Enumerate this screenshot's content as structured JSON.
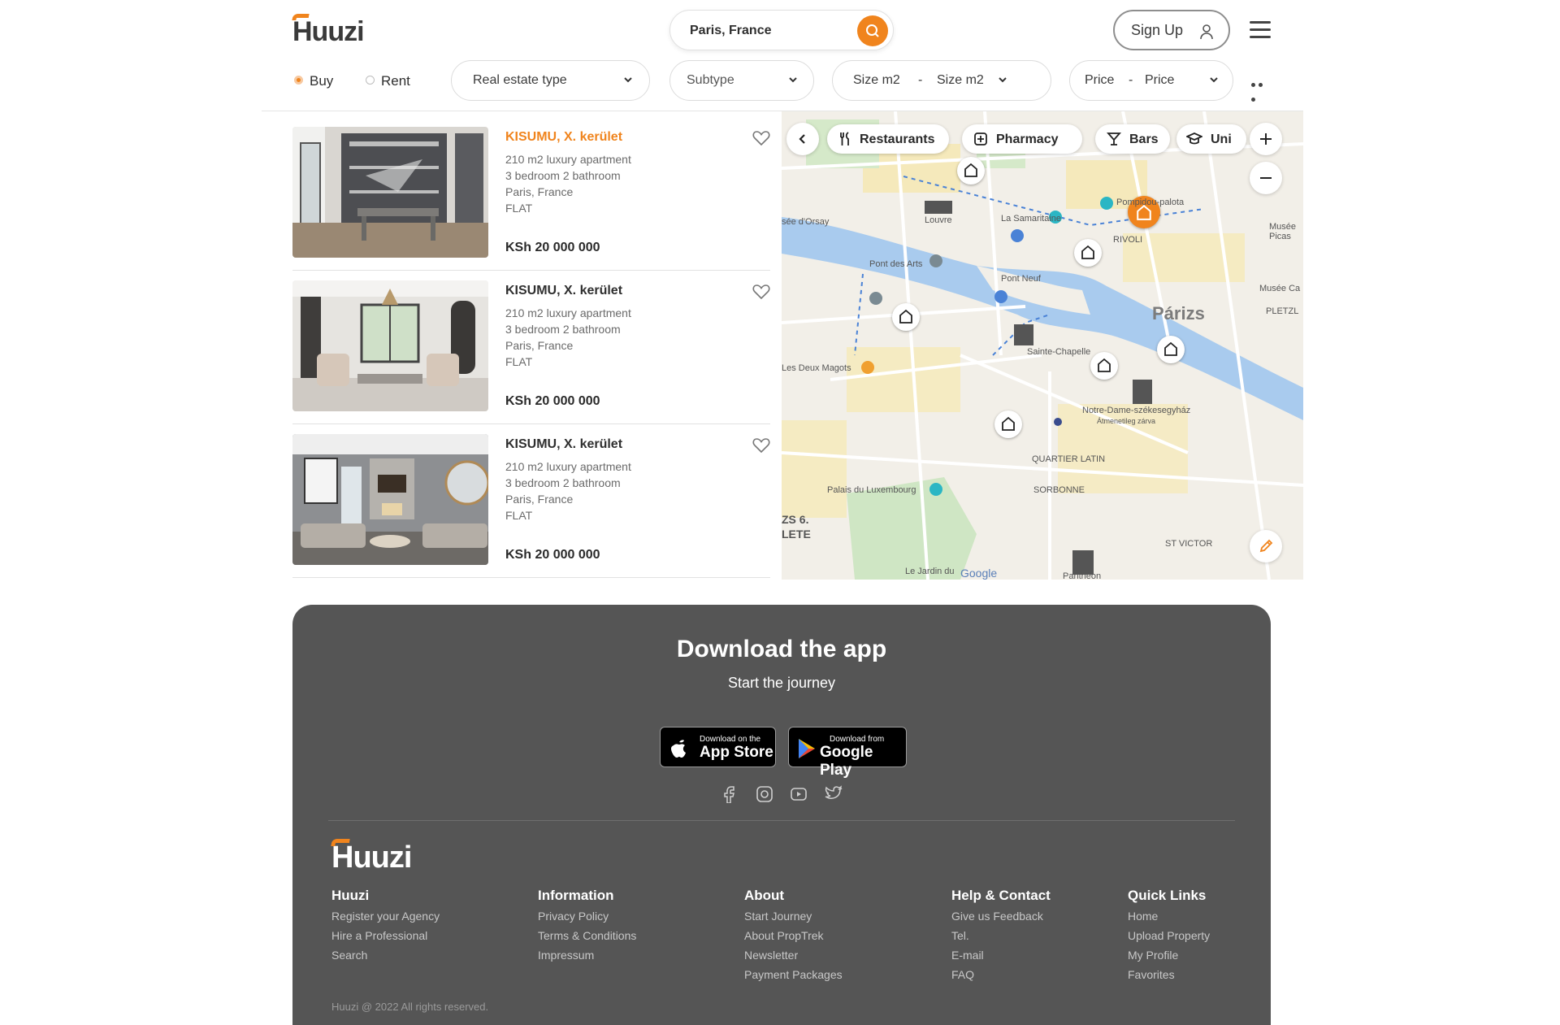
{
  "header": {
    "logo": "Huuzi",
    "search_value": "Paris, France",
    "signup_label": "Sign Up"
  },
  "filters": {
    "buy_label": "Buy",
    "rent_label": "Rent",
    "real_estate_type": "Real estate type",
    "subtype": "Subtype",
    "size_min": "Size m2",
    "size_sep": "-",
    "size_max": "Size m2",
    "price_min": "Price",
    "price_sep": "-",
    "price_max": "Price"
  },
  "listings": [
    {
      "title": "KISUMU, X. kerület",
      "line1": "210 m2 luxury apartment",
      "line2": "3 bedroom 2 bathroom",
      "line3": "Paris, France",
      "line4": "FLAT",
      "price": "KSh 20 000 000"
    },
    {
      "title": "KISUMU, X. kerület",
      "line1": "210 m2 luxury apartment",
      "line2": "3 bedroom 2 bathroom",
      "line3": "Paris, France",
      "line4": "FLAT",
      "price": "KSh 20 000 000"
    },
    {
      "title": "KISUMU, X. kerület",
      "line1": "210 m2 luxury apartment",
      "line2": "3 bedroom 2 bathroom",
      "line3": "Paris, France",
      "line4": "FLAT",
      "price": "KSh 20 000 000"
    }
  ],
  "map": {
    "chips": {
      "restaurants": "Restaurants",
      "pharmacy": "Pharmacy",
      "bars": "Bars",
      "uni": "Uni"
    },
    "labels": {
      "louvre": "Louvre",
      "samaritaine": "La Samaritaine",
      "pompidou": "Pompidou-palota",
      "rivoli": "RIVOLI",
      "pont_des_arts": "Pont des Arts",
      "pont_neuf": "Pont Neuf",
      "parizs": "Párizs",
      "sainte_chapelle": "Sainte-Chapelle",
      "deux_magots": "Les Deux Magots",
      "notre_dame": "Notre-Dame-székesegyház",
      "notre_dame_sub": "Átmenetileg zárva",
      "quartier_latin": "QUARTIER LATIN",
      "sorbonne": "SORBONNE",
      "luxembourg": "Palais du Luxembourg",
      "jardin": "Le Jardin du",
      "pantheon": "Panthéon",
      "st_victor": "ST VICTOR",
      "orsay": "sée d'Orsay",
      "pletzl": "PLETZL",
      "musee_ca": "Musée Ca",
      "musee_picas": "Musée Picas",
      "zs6": "ZS 6.",
      "lete": "LETE",
      "google": "Google"
    }
  },
  "footer": {
    "download_title": "Download the app",
    "download_sub": "Start the journey",
    "appstore_small": "Download on the",
    "appstore_big": "App Store",
    "gplay_small": "Download from",
    "gplay_big": "Google Play",
    "logo": "Huuzi",
    "columns": [
      {
        "title": "Huuzi",
        "links": [
          "Register your Agency",
          "Hire a Professional",
          "Search"
        ]
      },
      {
        "title": "Information",
        "links": [
          "Privacy Policy",
          "Terms & Conditions",
          "Impressum"
        ]
      },
      {
        "title": "About",
        "links": [
          "Start Journey",
          "About PropTrek",
          "Newsletter",
          "Payment Packages"
        ]
      },
      {
        "title": "Help & Contact",
        "links": [
          "Give us Feedback",
          "Tel.",
          "E-mail",
          "FAQ"
        ]
      },
      {
        "title": "Quick Links",
        "links": [
          "Home",
          "Upload Property",
          "My Profile",
          "Favorites"
        ]
      }
    ],
    "copyright": "Huuzi @ 2022 All rights reserved."
  },
  "colors": {
    "accent": "#f0841d",
    "footer_bg": "#555555"
  }
}
